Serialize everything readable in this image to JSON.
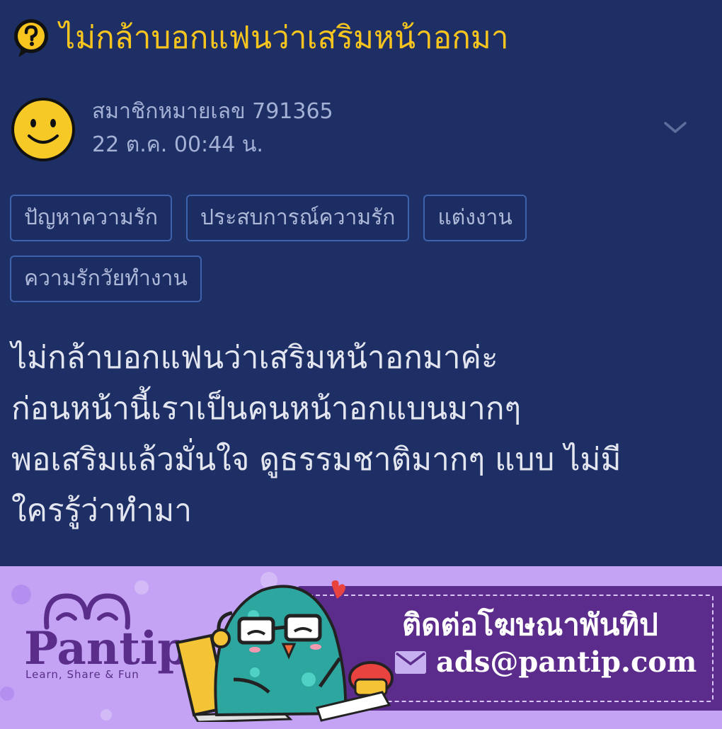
{
  "post": {
    "title": "ไม่กล้าบอกแฟนว่าเสริมหน้าอกมา",
    "author": "สมาชิกหมายเลข 791365",
    "timestamp": "22 ต.ค. 00:44 น.",
    "tags": [
      "ปัญหาความรัก",
      "ประสบการณ์ความรัก",
      "แต่งงาน",
      "ความรักวัยทำงาน"
    ],
    "body_lines": [
      "ไม่กล้าบอกแฟนว่าเสริมหน้าอกมาค่ะ",
      "ก่อนหน้านี้เราเป็นคนหน้าอกแบนมากๆ",
      "พอเสริมแล้วมั่นใจ ดูธรรมชาติมากๆ แบบ ไม่มี",
      "ใครรู้ว่าทำมา"
    ]
  },
  "ad": {
    "logo_text": "Pantip",
    "logo_tagline": "Learn, Share & Fun",
    "contact_label": "ติดต่อโฆษณาพันทิป",
    "email": "ads@pantip.com"
  },
  "colors": {
    "background": "#1e2f66",
    "title": "#f7c51e",
    "tag_border": "#3f62ad",
    "ad_background": "#c4a3f5",
    "ad_band": "#5b2c8c"
  },
  "icons": [
    "question-icon",
    "smiley-avatar",
    "chevron-down-icon",
    "mail-icon",
    "pantip-mascot"
  ]
}
